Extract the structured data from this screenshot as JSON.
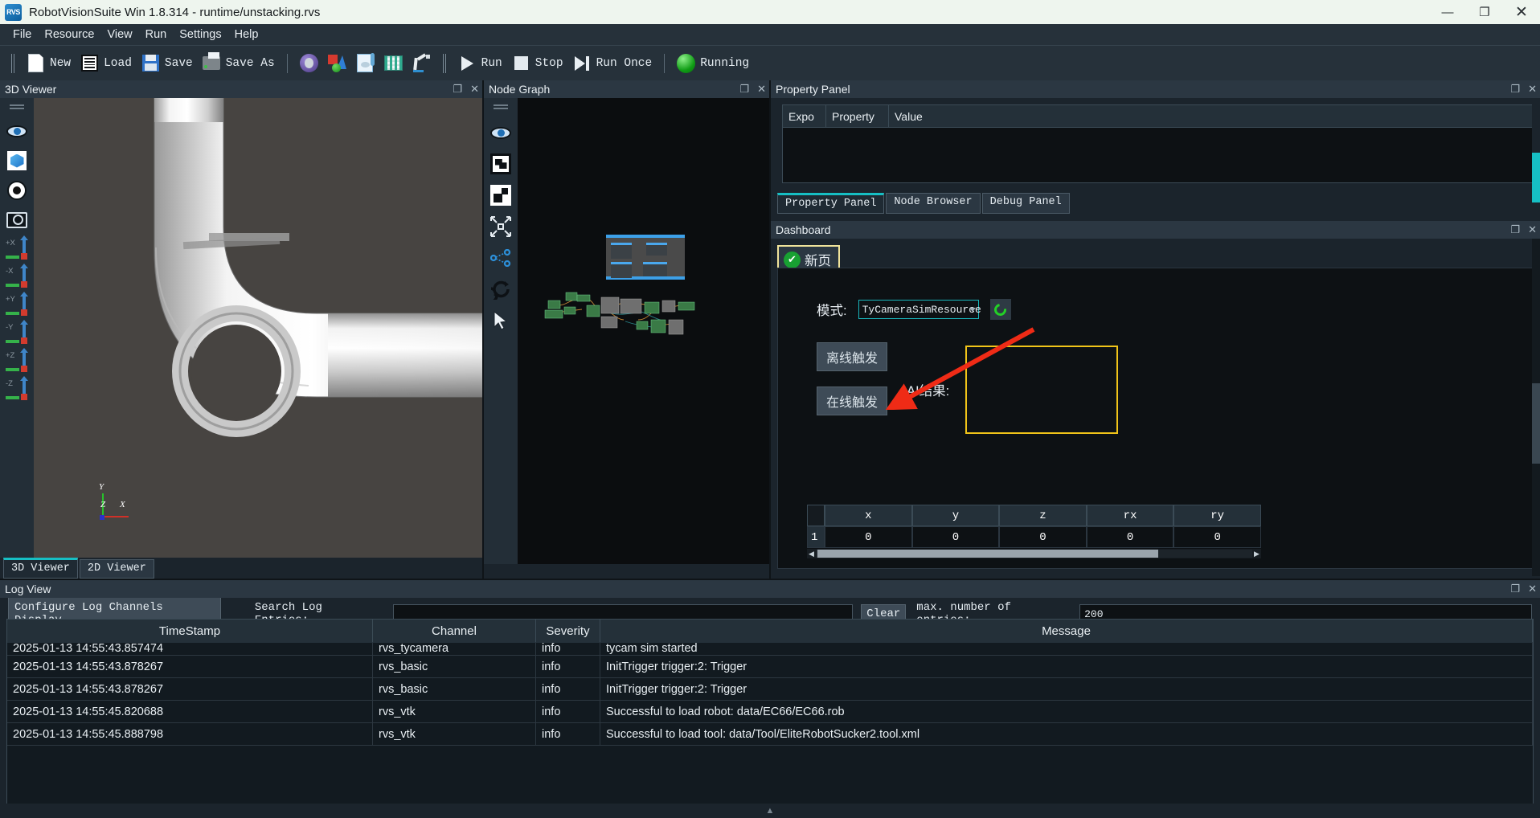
{
  "window": {
    "logo_text": "RVS",
    "title": "RobotVisionSuite Win 1.8.314 - runtime/unstacking.rvs",
    "minimize": "—",
    "maximize": "❐",
    "close": "✕"
  },
  "menubar": {
    "items": [
      "File",
      "Resource",
      "View",
      "Run",
      "Settings",
      "Help"
    ]
  },
  "toolbar": {
    "new_label": "New",
    "load_label": "Load",
    "save_label": "Save",
    "save_as_label": "Save As",
    "run_label": "Run",
    "stop_label": "Stop",
    "run_once_label": "Run Once",
    "running_label": "Running"
  },
  "viewer3d": {
    "title": "3D Viewer",
    "restore": "❐",
    "close": "✕",
    "axis_labels": {
      "y": "Y",
      "x": "X",
      "z": "Z"
    },
    "tools": [
      "eye-icon",
      "cube-icon",
      "target-icon",
      "camera-icon",
      "+X",
      "-X",
      "+Y",
      "-Y",
      "+Z",
      "-Z"
    ],
    "axis_buttons": [
      {
        "label": "+X"
      },
      {
        "label": "-X"
      },
      {
        "label": "+Y"
      },
      {
        "label": "-Y"
      },
      {
        "label": "+Z"
      },
      {
        "label": "-Z"
      }
    ],
    "tabs": [
      {
        "label": "3D Viewer",
        "active": true
      },
      {
        "label": "2D Viewer",
        "active": false
      }
    ]
  },
  "nodegraph": {
    "title": "Node Graph",
    "restore": "❐",
    "close": "✕",
    "tools": [
      "eye-icon",
      "select-icon",
      "group-icon",
      "fit-icon",
      "share-icon",
      "refresh-icon",
      "cursor-icon"
    ]
  },
  "property_panel": {
    "title": "Property Panel",
    "restore": "❐",
    "close": "✕",
    "columns": [
      "Expo",
      "Property",
      "Value"
    ],
    "rows": [],
    "tabs": [
      {
        "label": "Property Panel",
        "active": true
      },
      {
        "label": "Node Browser",
        "active": false
      },
      {
        "label": "Debug Panel",
        "active": false
      }
    ]
  },
  "dashboard": {
    "title": "Dashboard",
    "restore": "❐",
    "close": "✕",
    "page_tab": {
      "label": "新页",
      "check": "✔"
    },
    "mode_label": "模式:",
    "mode_value": "TyCameraSimResource",
    "refresh_icon": "refresh-icon",
    "offline_trigger_label": "离线触发",
    "online_trigger_label": "在线触发",
    "ai_result_label": "AI结果:",
    "ai_result_value": "",
    "accent_yellow": "#f0c419",
    "accent_teal": "#19b5bb",
    "table": {
      "columns": [
        "",
        "x",
        "y",
        "z",
        "rx",
        "ry"
      ],
      "rows": [
        {
          "index": "1",
          "cells": [
            "0",
            "0",
            "0",
            "0",
            "0"
          ]
        }
      ]
    }
  },
  "logview": {
    "title": "Log View",
    "restore": "❐",
    "close": "✕",
    "configure_button": "Configure Log Channels Display",
    "search_label": "Search Log Entries:",
    "search_value": "",
    "clear_button": "Clear",
    "max_entries_label": "max. number of entries:",
    "max_entries_value": "200",
    "columns": [
      "TimeStamp",
      "Channel",
      "Severity",
      "Message"
    ],
    "rows": [
      {
        "timestamp": "2025-01-13 14:55:43.857474",
        "channel": "rvs_tycamera",
        "severity": "info",
        "message": "tycam sim started",
        "clipped": true
      },
      {
        "timestamp": "2025-01-13 14:55:43.878267",
        "channel": "rvs_basic",
        "severity": "info",
        "message": "InitTrigger trigger:2: Trigger",
        "clipped": false
      },
      {
        "timestamp": "2025-01-13 14:55:43.878267",
        "channel": "rvs_basic",
        "severity": "info",
        "message": "InitTrigger trigger:2: Trigger",
        "clipped": false
      },
      {
        "timestamp": "2025-01-13 14:55:45.820688",
        "channel": "rvs_vtk",
        "severity": "info",
        "message": "Successful to load robot: data/EC66/EC66.rob",
        "clipped": false
      },
      {
        "timestamp": "2025-01-13 14:55:45.888798",
        "channel": "rvs_vtk",
        "severity": "info",
        "message": "Successful to load tool: data/Tool/EliteRobotSucker2.tool.xml",
        "clipped": false
      }
    ]
  },
  "statusbar": {
    "marker": "▲"
  }
}
